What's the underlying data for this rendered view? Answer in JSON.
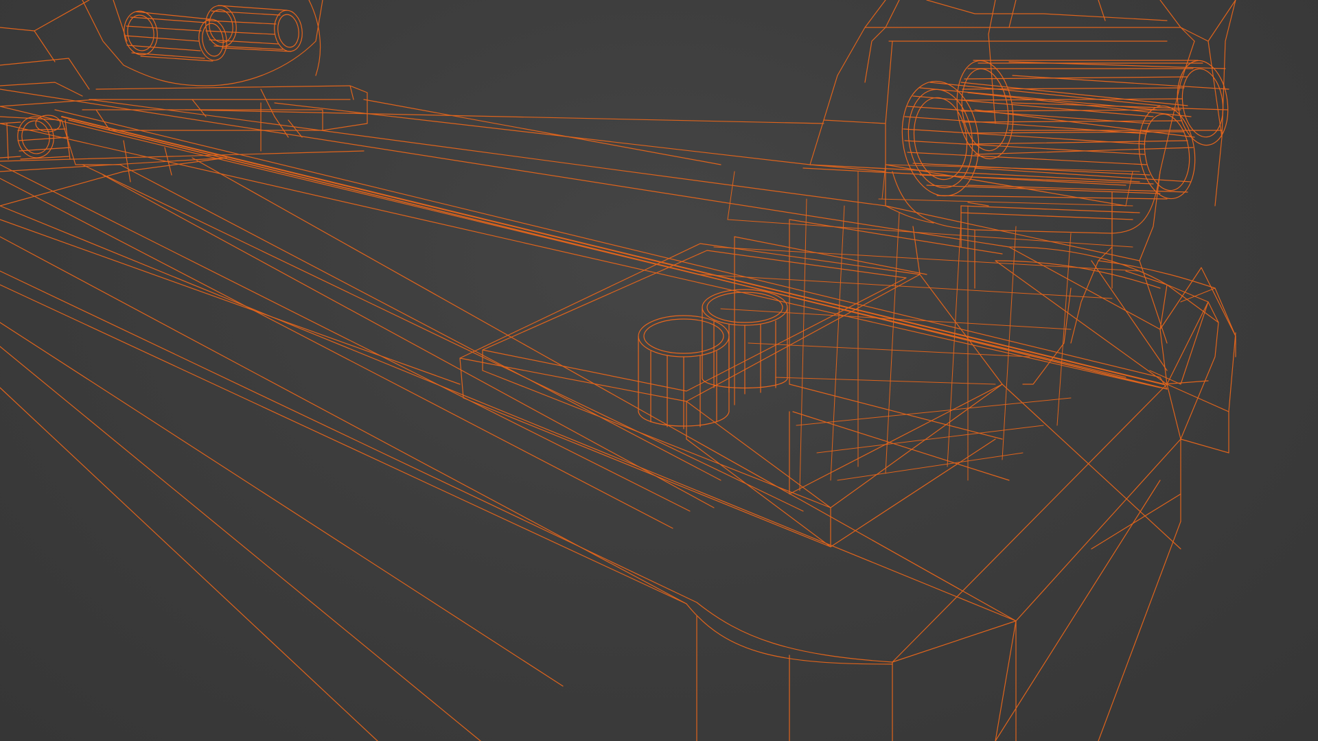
{
  "scene": {
    "kind": "3d-viewport",
    "view_mode": "wireframe",
    "colors": {
      "background": "#3a3a3a",
      "wire": "#e0641c",
      "wire_dim": "#c65a1f",
      "wire_bright": "#f0782a"
    }
  }
}
